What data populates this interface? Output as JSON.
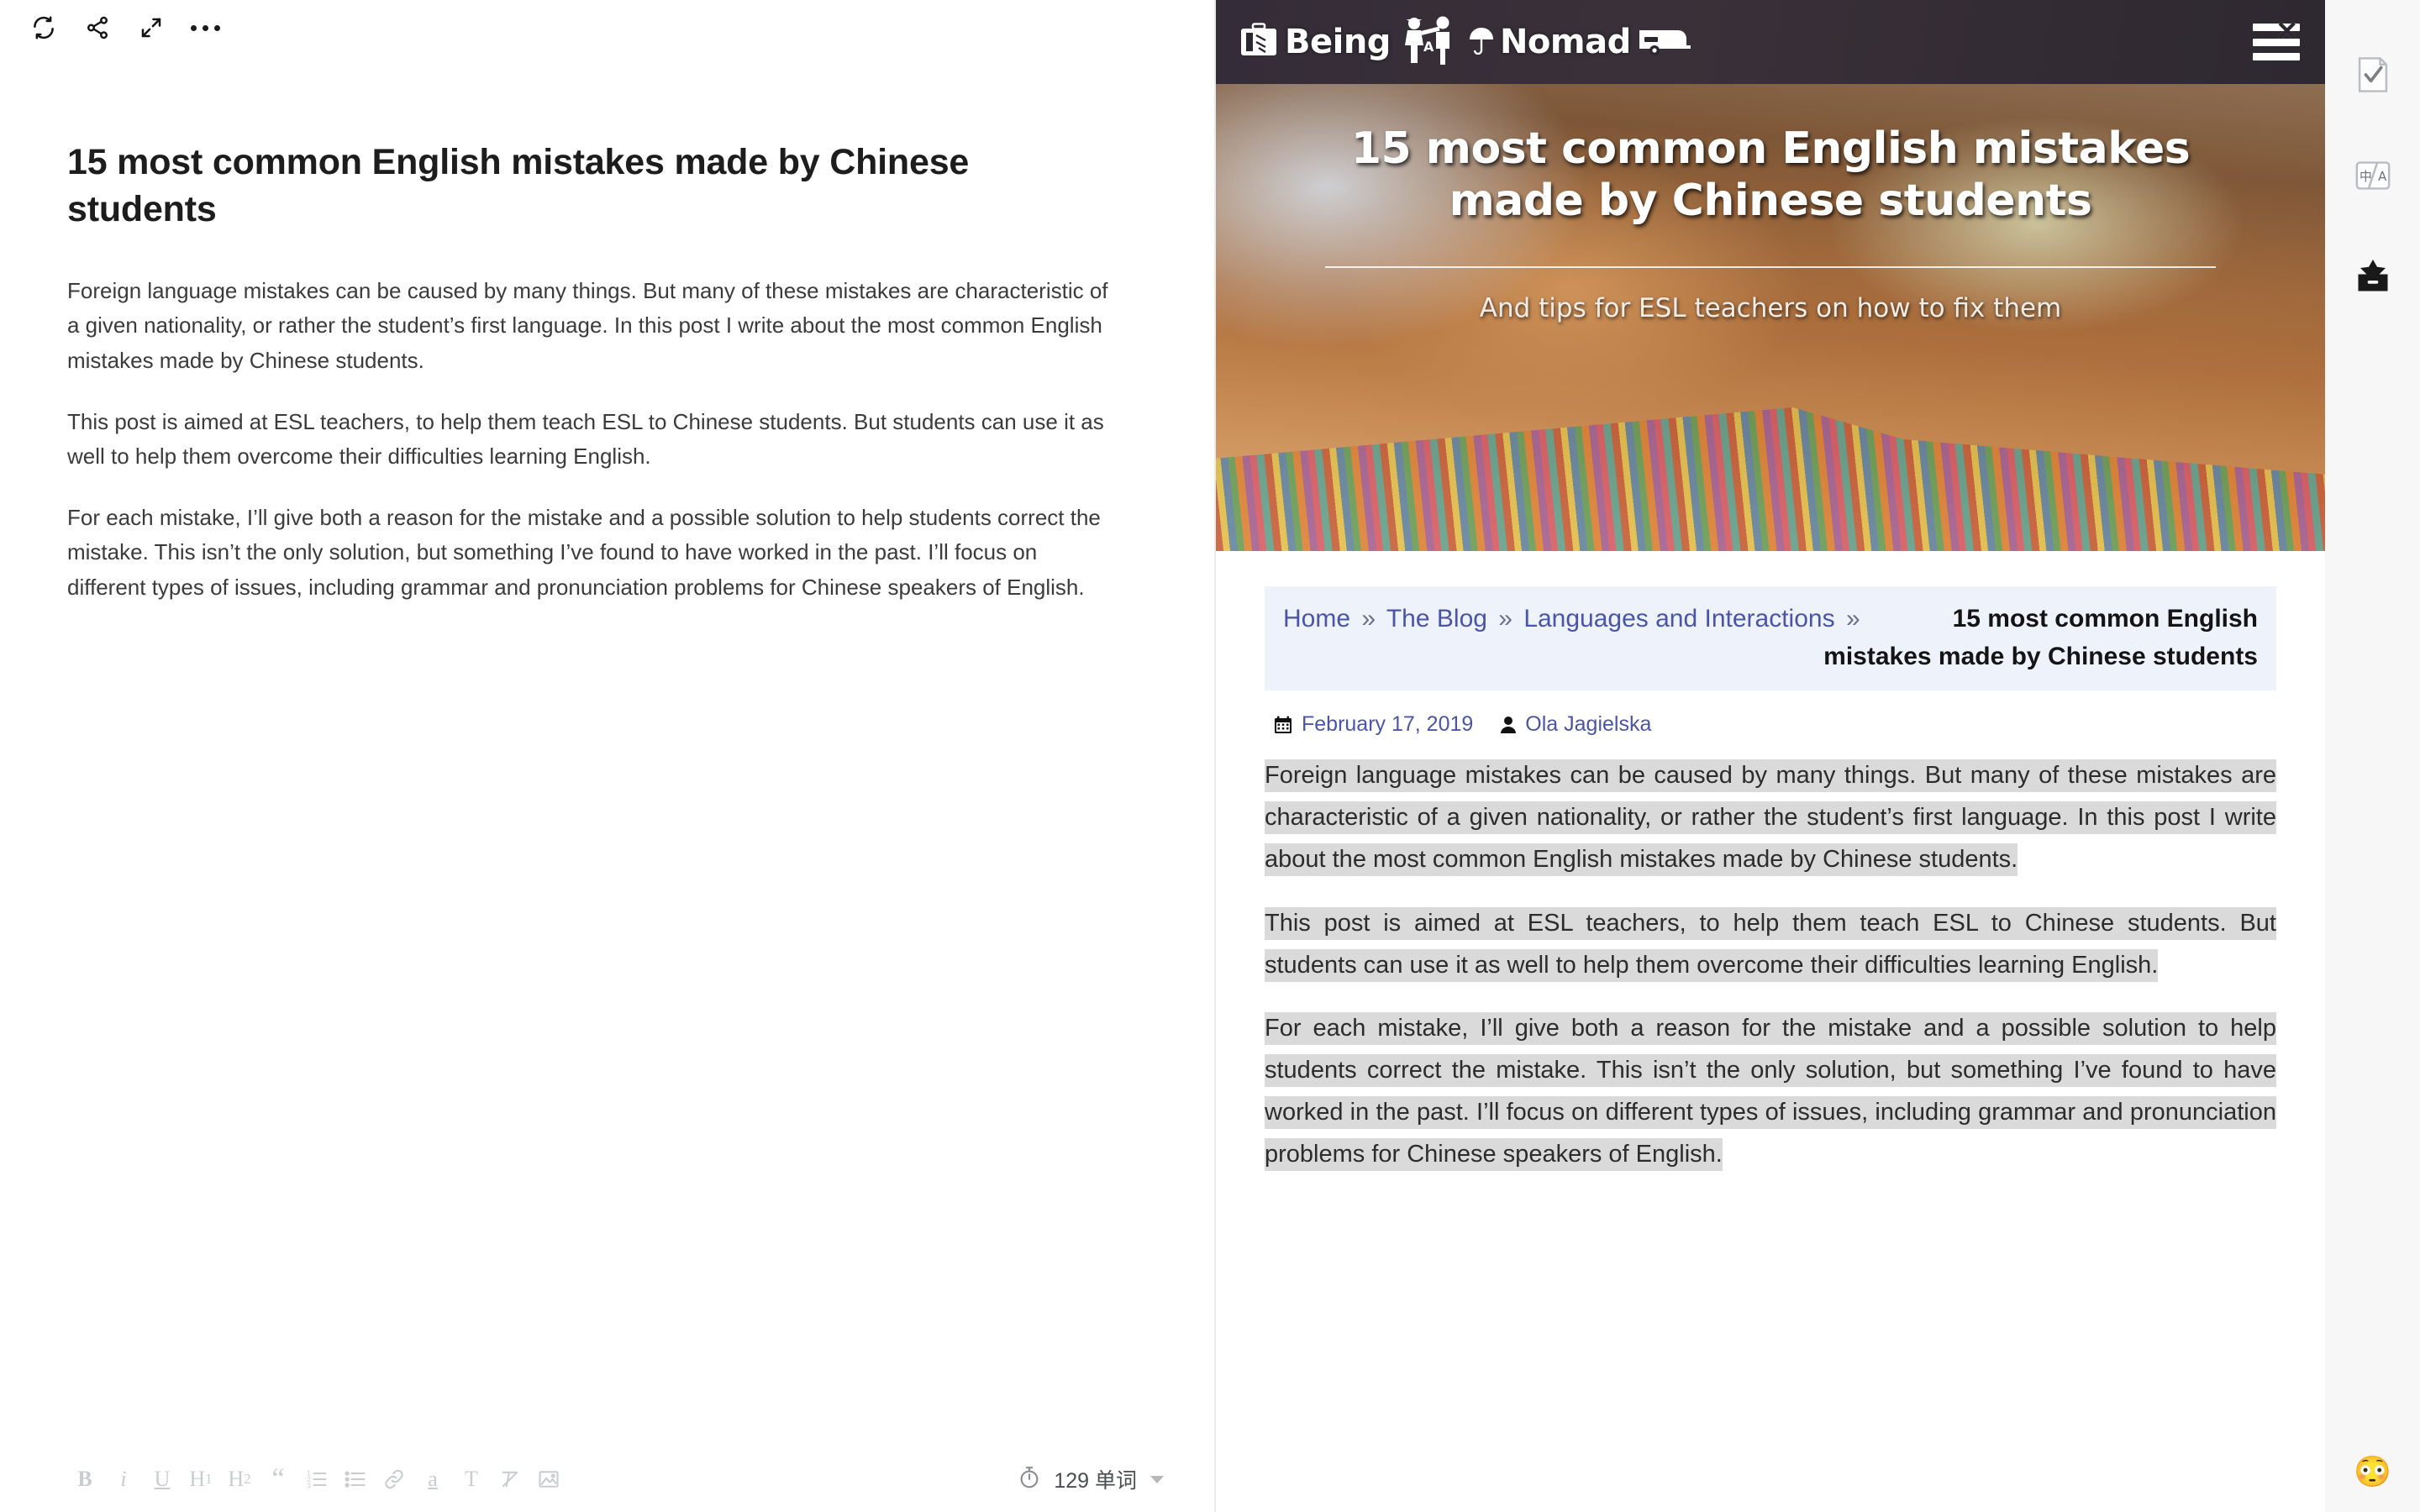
{
  "editor": {
    "toolbar_top": [
      {
        "name": "refresh-sync",
        "label": "Sync"
      },
      {
        "name": "share",
        "label": "Share"
      },
      {
        "name": "fullscreen",
        "label": "Fullscreen"
      },
      {
        "name": "more-options",
        "label": "More"
      }
    ],
    "document": {
      "title": "15 most common English mistakes made by Chinese students",
      "paragraphs": [
        "Foreign language mistakes can be caused by many things. But many of these mistakes are characteristic of a given nationality, or rather the student’s first language. In this post I write about the most common English mistakes made by Chinese students.",
        "This post is aimed at ESL teachers, to help them teach ESL to Chinese students. But students can use it as well to help them overcome their difficulties learning English.",
        "For each mistake, I’ll give both a reason for the mistake and a possible solution to help students correct the mistake. This isn’t the only solution, but something I’ve found to have worked in the past. I’ll focus on different types of issues, including grammar and pronunciation problems for Chinese speakers of English."
      ]
    },
    "format_toolbar": [
      {
        "name": "bold",
        "label": "B"
      },
      {
        "name": "italic",
        "label": "i"
      },
      {
        "name": "underline",
        "label": "U"
      },
      {
        "name": "heading-1",
        "label": "H",
        "sub": "1"
      },
      {
        "name": "heading-2",
        "label": "H",
        "sub": "2"
      },
      {
        "name": "blockquote",
        "label": "“"
      },
      {
        "name": "ordered-list",
        "label": ""
      },
      {
        "name": "unordered-list",
        "label": ""
      },
      {
        "name": "link",
        "label": ""
      },
      {
        "name": "highlight",
        "label": "a"
      },
      {
        "name": "text-style",
        "label": "T"
      },
      {
        "name": "clear-formatting",
        "label": ""
      },
      {
        "name": "insert-image",
        "label": ""
      }
    ],
    "status": {
      "word_count": "129 单词",
      "timer_icon": "stopwatch-icon"
    }
  },
  "site": {
    "logo": {
      "word_1": "Being",
      "word_a": "A",
      "word_2": "Nomad",
      "icons": [
        "suitcase-icon",
        "two-people-icon",
        "umbrella-icon",
        "caravan-icon"
      ]
    },
    "menu_label": "Menu",
    "hero": {
      "title": "15 most common English mistakes made by Chinese students",
      "subtitle": "And tips for ESL teachers on how to fix them"
    },
    "breadcrumb": {
      "items": [
        {
          "label": "Home",
          "link": true
        },
        {
          "label": "The Blog",
          "link": true
        },
        {
          "label": "Languages and Interactions",
          "link": true
        }
      ],
      "separator": "»",
      "current": "15 most common English mistakes made by Chinese students"
    },
    "post_meta": {
      "date": "February 17, 2019",
      "author": "Ola Jagielska",
      "date_icon": "calendar-icon",
      "author_icon": "user-icon"
    },
    "post_paragraphs": [
      "Foreign language mistakes can be caused by many things. But many of these mistakes are characteristic of a given nationality, or rather the student’s first language. In this post I write about the most common English mistakes made by Chinese students.",
      "This post is aimed at ESL teachers, to help them teach ESL to Chinese students. But students can use it as well to help them overcome their difficulties learning English.",
      "For each mistake, I’ll give both a reason for the mistake and a possible solution to help students correct the mistake. This isn’t the only solution, but something I’ve found to have worked in the past. I’ll focus on different types of issues, including grammar and pronunciation problems for Chinese speakers of English."
    ]
  },
  "right_sidebar": {
    "items": [
      {
        "name": "task-check-icon",
        "label": "Tasks"
      },
      {
        "name": "translate-icon",
        "label": "Translate"
      },
      {
        "name": "collection-star-icon",
        "label": "Collection"
      }
    ],
    "emoji_button": "😳"
  },
  "colors": {
    "accent_link": "#4a55a8",
    "breadcrumb_bg": "#eef2fb",
    "selection_bg": "#dadada",
    "header_bg": "#2b2630",
    "sidebar_bg": "#f7f7f8"
  }
}
